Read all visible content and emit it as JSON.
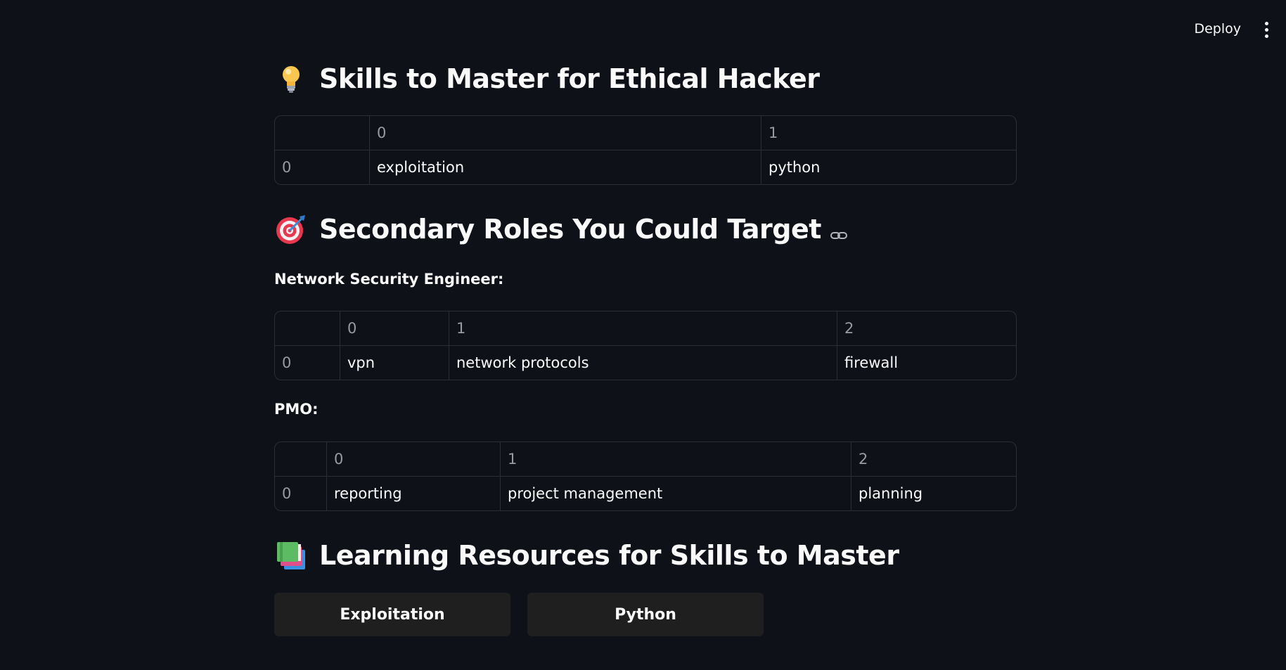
{
  "header": {
    "deploy_label": "Deploy",
    "menu_icon": "vertical-dots-icon"
  },
  "sections": {
    "skills": {
      "icon": "lightbulb-icon",
      "title": "Skills to Master for Ethical Hacker",
      "table": {
        "columns": [
          "",
          "0",
          "1"
        ],
        "rows": [
          [
            "0",
            "exploitation",
            "python"
          ]
        ]
      }
    },
    "secondary_roles": {
      "icon": "target-icon",
      "title": "Secondary Roles You Could Target",
      "anchor_icon": "link-icon",
      "roles": [
        {
          "label": "Network Security Engineer:",
          "table": {
            "columns": [
              "",
              "0",
              "1",
              "2"
            ],
            "rows": [
              [
                "0",
                "vpn",
                "network protocols",
                "firewall"
              ]
            ]
          }
        },
        {
          "label": "PMO:",
          "table": {
            "columns": [
              "",
              "0",
              "1",
              "2"
            ],
            "rows": [
              [
                "0",
                "reporting",
                "project management",
                "planning"
              ]
            ]
          }
        }
      ]
    },
    "resources": {
      "icon": "books-icon",
      "title": "Learning Resources for Skills to Master",
      "buttons": [
        "Exploitation",
        "Python"
      ]
    }
  },
  "colors": {
    "background": "#0e1117",
    "text": "#fafafa",
    "muted": "#9a9ba1",
    "border": "#2b2e36",
    "button_bg": "#1f1f1f"
  }
}
